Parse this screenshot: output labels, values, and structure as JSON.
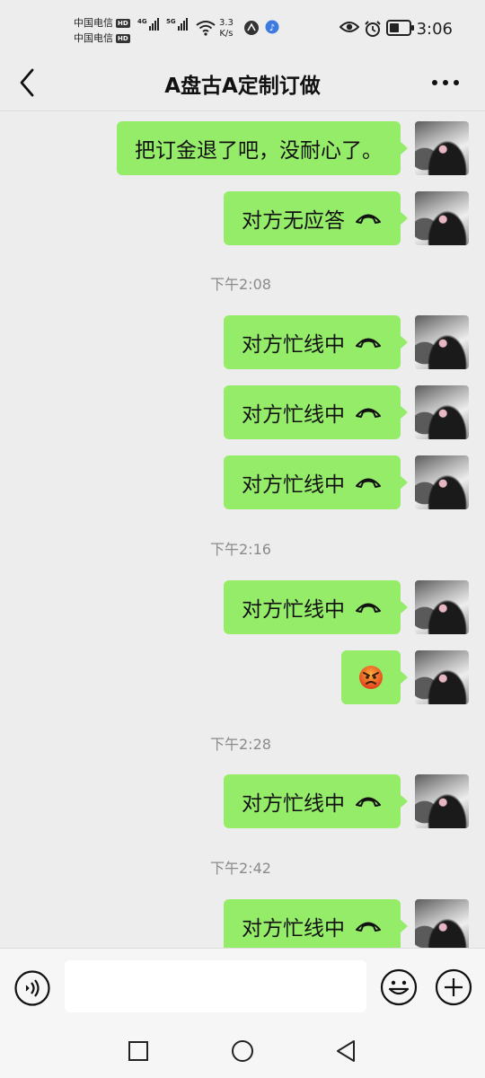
{
  "status_bar": {
    "carrier1": "中国电信",
    "carrier2": "中国电信",
    "hd_badge": "HD",
    "network1": "4G",
    "network2": "5G",
    "speed_value": "3.3",
    "speed_unit": "K/s",
    "time": "3:06"
  },
  "header": {
    "title": "A盘古A定制订做"
  },
  "chat": {
    "messages": [
      {
        "text": "把订金退了吧，没耐心了。"
      },
      {
        "text": "对方无应答"
      },
      {
        "timestamp": "下午2:08"
      },
      {
        "text": "对方忙线中"
      },
      {
        "text": "对方忙线中"
      },
      {
        "text": "对方忙线中"
      },
      {
        "timestamp": "下午2:16"
      },
      {
        "text": "对方忙线中"
      },
      {
        "emoji": "angry-face"
      },
      {
        "timestamp": "下午2:28"
      },
      {
        "text": "对方忙线中"
      },
      {
        "timestamp": "下午2:42"
      },
      {
        "text": "对方忙线中"
      }
    ]
  },
  "input": {
    "value": "",
    "placeholder": ""
  },
  "colors": {
    "background": "#ededed",
    "bubble": "#95ec69",
    "timestamp": "#8a8a8a"
  }
}
